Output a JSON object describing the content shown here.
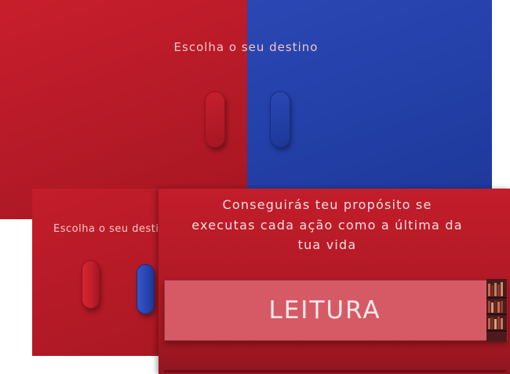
{
  "top_panel": {
    "title": "Escolha o seu destino",
    "colors": {
      "red": "#b51a27",
      "blue": "#2340a8"
    }
  },
  "middle_panel": {
    "title": "Escolha o seu destino"
  },
  "front_panel": {
    "quote_lines": [
      "Conseguirás teu propósito se",
      "executas cada ação como a última da",
      "tua vida"
    ],
    "card_label": "LEITURA",
    "card_icon": "bookshelf-icon"
  },
  "pills": [
    "red-pill",
    "blue-pill"
  ]
}
